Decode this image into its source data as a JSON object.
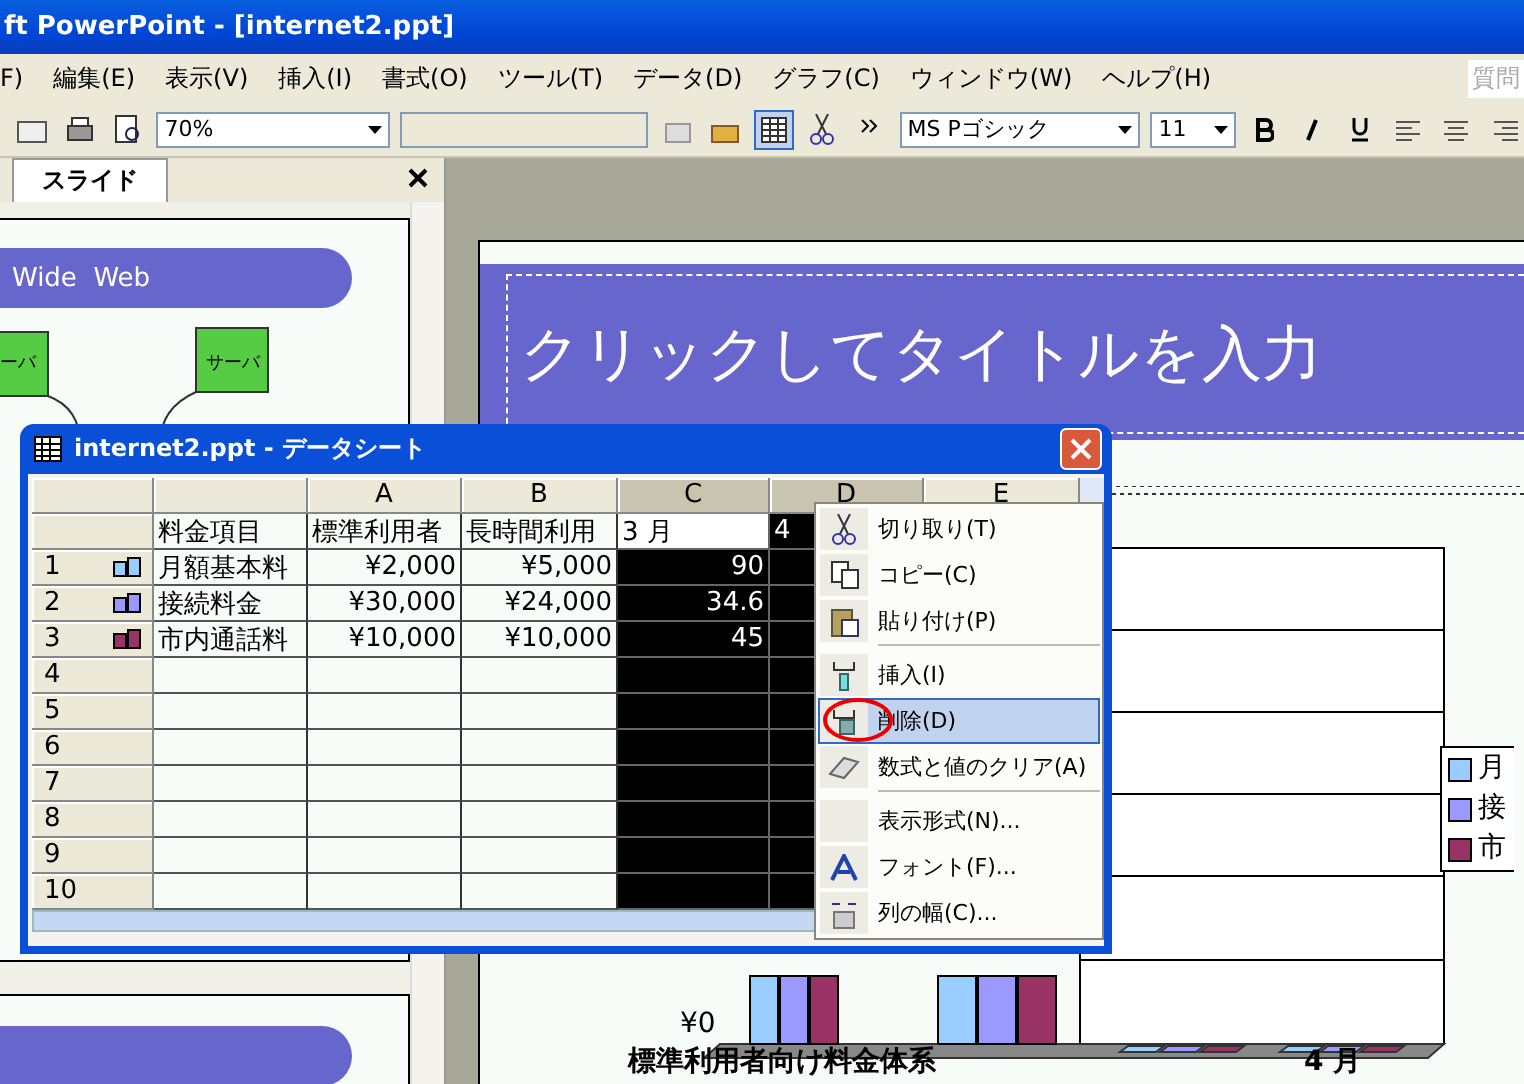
{
  "window": {
    "title": "ft PowerPoint - [internet2.ppt]"
  },
  "menu": [
    "F)",
    "編集(E)",
    "表示(V)",
    "挿入(I)",
    "書式(O)",
    "ツール(T)",
    "データ(D)",
    "グラフ(C)",
    "ウィンドウ(W)",
    "ヘルプ(H)"
  ],
  "help_box": "質問",
  "toolbar": {
    "zoom": "70%",
    "font": "MS Pゴシック",
    "size": "11"
  },
  "pane": {
    "tabs": [
      {
        "label": "スライド",
        "selected": true
      }
    ],
    "thumbnail": {
      "title": "Wide  Web",
      "servers": [
        "ーバ",
        "サーバ"
      ]
    }
  },
  "slide": {
    "title": "クリックしてタイトルを入力",
    "chart": {
      "y_tick": "¥0",
      "category_1": "標準利用者向け料金体系",
      "category_2": "4 月",
      "legend": [
        {
          "label": "月",
          "color": "#99ccff"
        },
        {
          "label": "接",
          "color": "#9999ff"
        },
        {
          "label": "市",
          "color": "#993366"
        }
      ]
    }
  },
  "datasheet": {
    "title": "internet2.ppt - データシート",
    "columns": [
      {
        "selected": false
      },
      {
        "label": "A",
        "selected": false
      },
      {
        "label": "B",
        "selected": false
      },
      {
        "label": "C",
        "selected": true
      },
      {
        "label": "D",
        "selected": true
      },
      {
        "label": "E",
        "selected": false
      }
    ],
    "rows": [
      {
        "active": true,
        "cells": [
          "料金項目",
          "標準利用者",
          "長時間利用",
          "3 月",
          "4"
        ]
      },
      {
        "header": "1",
        "color": "#99ccff",
        "active": false,
        "cells": [
          "月額基本料",
          "¥2,000",
          "¥5,000",
          "90"
        ]
      },
      {
        "header": "2",
        "color": "#9999ff",
        "active": false,
        "cells": [
          "接続料金",
          "¥30,000",
          "¥24,000",
          "34.6"
        ]
      },
      {
        "header": "3",
        "color": "#993366",
        "active": false,
        "cells": [
          "市内通話料",
          "¥10,000",
          "¥10,000",
          "45"
        ]
      },
      {
        "header": "4",
        "active": false
      },
      {
        "header": "5",
        "active": false
      },
      {
        "header": "6",
        "active": false
      },
      {
        "header": "7",
        "active": false
      },
      {
        "header": "8",
        "active": false
      },
      {
        "header": "9",
        "active": false
      },
      {
        "header": "10",
        "active": false
      }
    ]
  },
  "context_menu": [
    {
      "kind": "item",
      "label": "切り取り(T)",
      "selected": false
    },
    {
      "kind": "item",
      "label": "コピー(C)",
      "selected": false
    },
    {
      "kind": "item",
      "label": "貼り付け(P)",
      "selected": false
    },
    {
      "kind": "separator"
    },
    {
      "kind": "item",
      "label": "挿入(I)",
      "selected": false
    },
    {
      "kind": "item",
      "label": "削除(D)",
      "selected": true
    },
    {
      "kind": "item",
      "label": "数式と値のクリア(A)",
      "selected": false
    },
    {
      "kind": "separator"
    },
    {
      "kind": "item",
      "label": "表示形式(N)...",
      "selected": false
    },
    {
      "kind": "item",
      "label": "フォント(F)...",
      "selected": false
    },
    {
      "kind": "item",
      "label": "列の幅(C)...",
      "selected": false
    }
  ]
}
